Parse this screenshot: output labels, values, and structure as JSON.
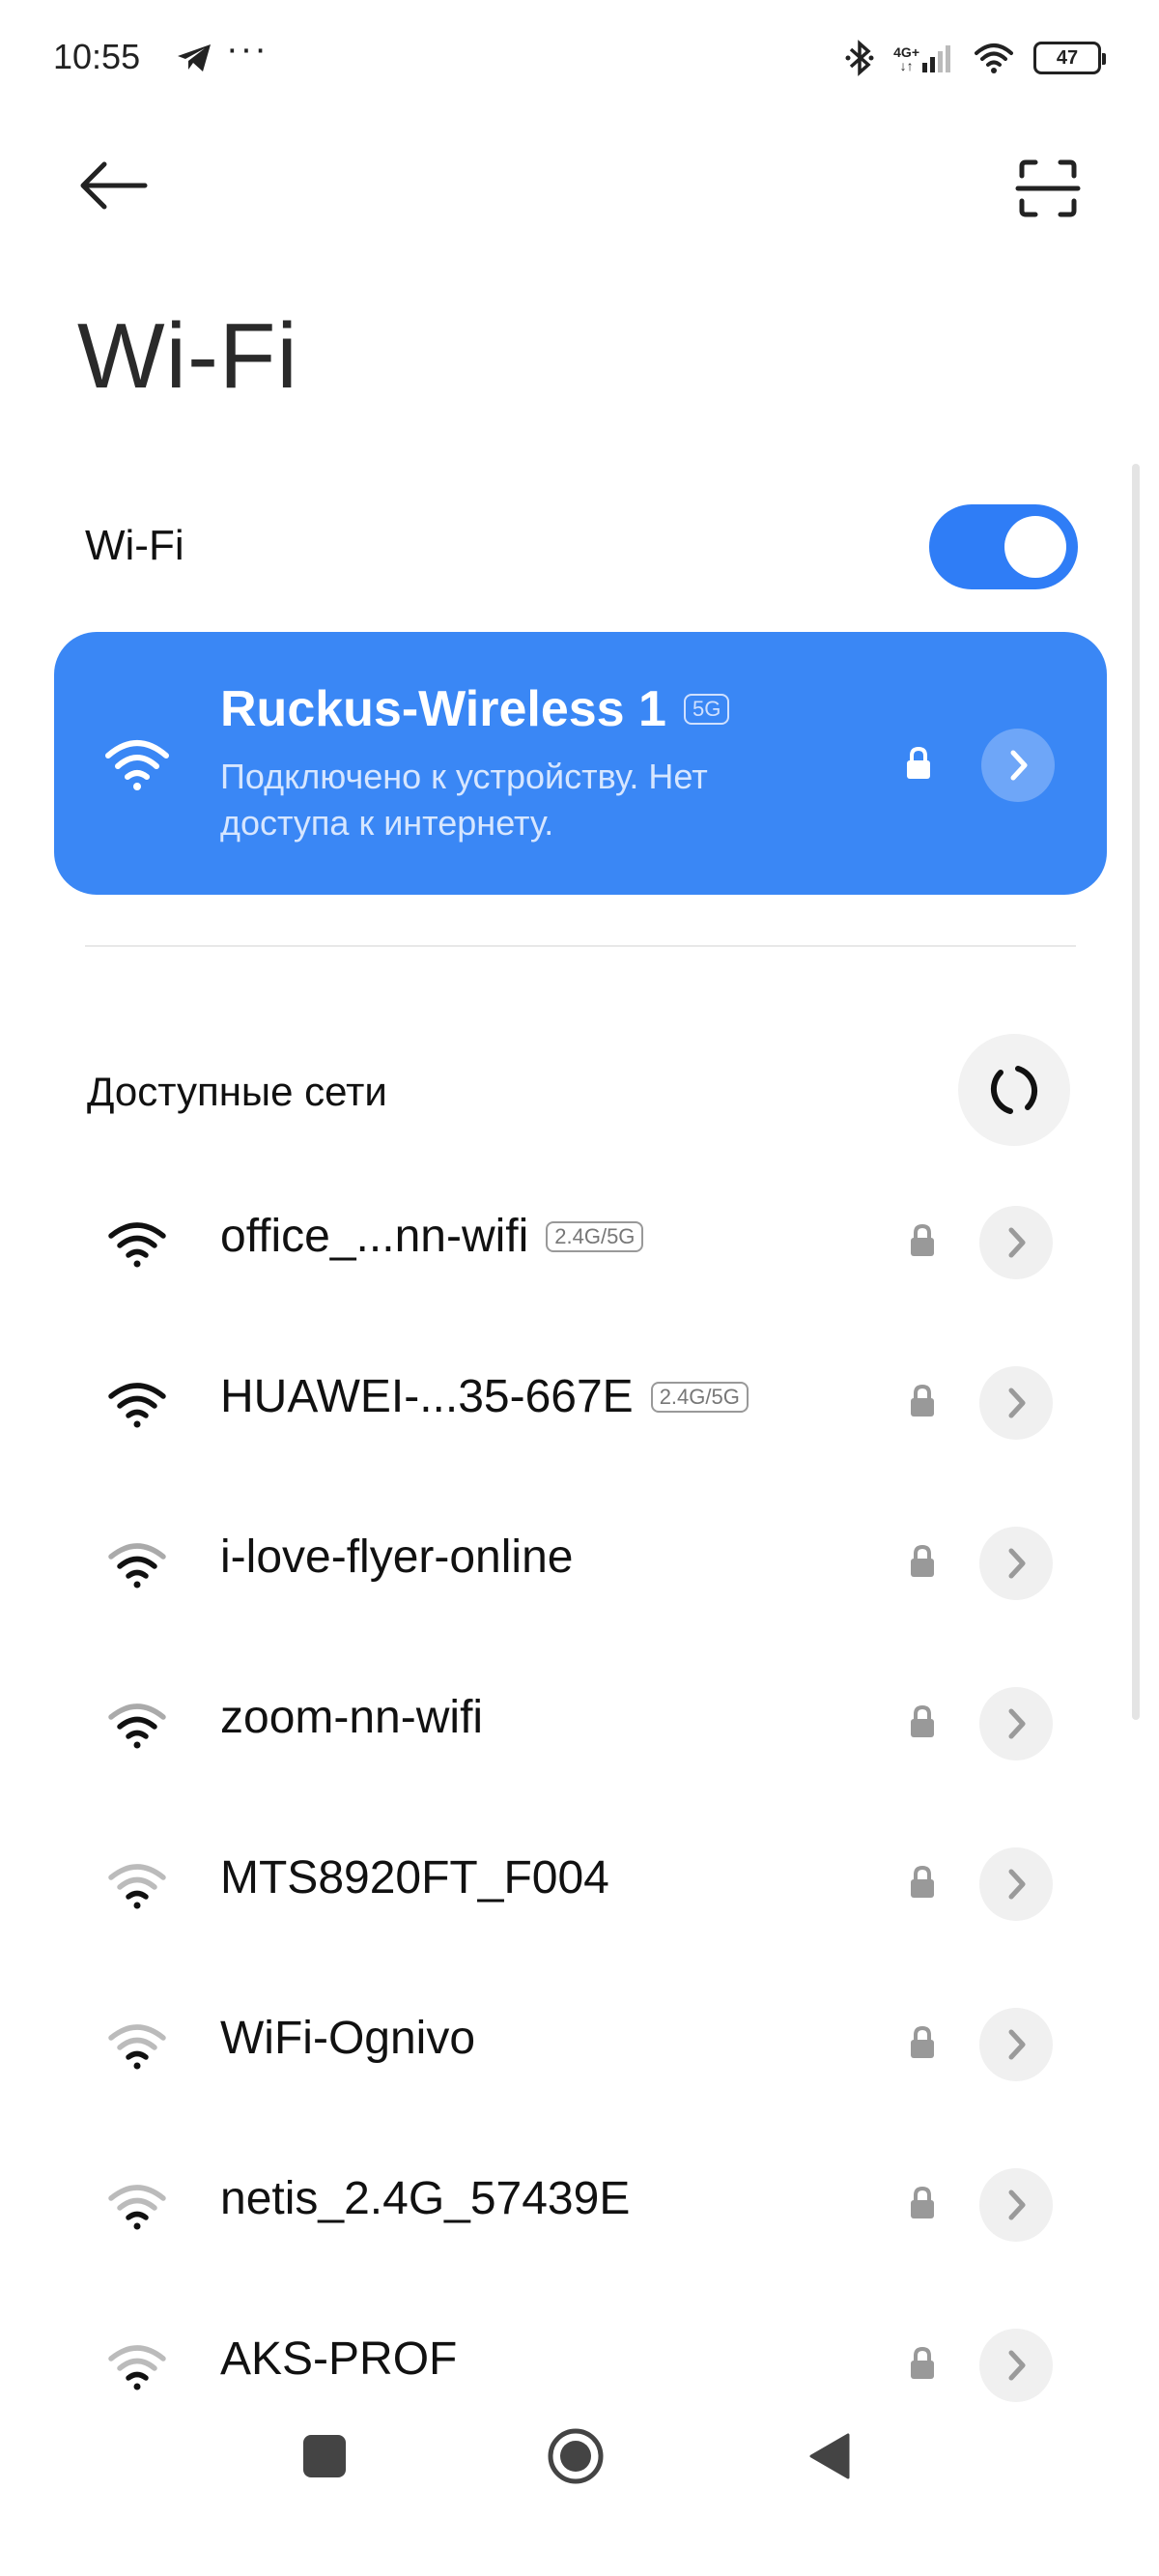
{
  "status_bar": {
    "time": "10:55",
    "more": "···",
    "network_type_top": "4G+",
    "network_type_bottom": "↓↑",
    "battery": "47"
  },
  "header": {
    "back_icon": "arrow-left-icon",
    "scan_icon": "qr-scan-icon",
    "title": "Wi-Fi"
  },
  "wifi_toggle": {
    "label": "Wi-Fi",
    "enabled": true,
    "color": "#2f7df6"
  },
  "connected_network": {
    "name": "Ruckus-Wireless 1",
    "band": "5G",
    "status": "Подключено к устройству. Нет доступа к интернету.",
    "secured": true,
    "card_color": "#3a87f5"
  },
  "available": {
    "label": "Доступные сети",
    "refresh_icon": "refresh-icon",
    "networks": [
      {
        "name": "office_...nn-wifi",
        "band": "2.4G/5G",
        "signal": 4,
        "secured": true
      },
      {
        "name": "HUAWEI-...35-667E",
        "band": "2.4G/5G",
        "signal": 4,
        "secured": true
      },
      {
        "name": "i-love-flyer-online",
        "band": "",
        "signal": 3,
        "secured": true
      },
      {
        "name": "zoom-nn-wifi",
        "band": "",
        "signal": 3,
        "secured": true
      },
      {
        "name": "MTS8920FT_F004",
        "band": "",
        "signal": 2,
        "secured": true
      },
      {
        "name": "WiFi-Ognivo",
        "band": "",
        "signal": 2,
        "secured": true
      },
      {
        "name": "netis_2.4G_57439E",
        "band": "",
        "signal": 2,
        "secured": true
      },
      {
        "name": "AKS-PROF",
        "band": "",
        "signal": 2,
        "secured": true
      }
    ]
  },
  "nav_bar": {
    "recents_icon": "square-icon",
    "home_icon": "circle-home-icon",
    "back_icon": "triangle-back-icon"
  }
}
